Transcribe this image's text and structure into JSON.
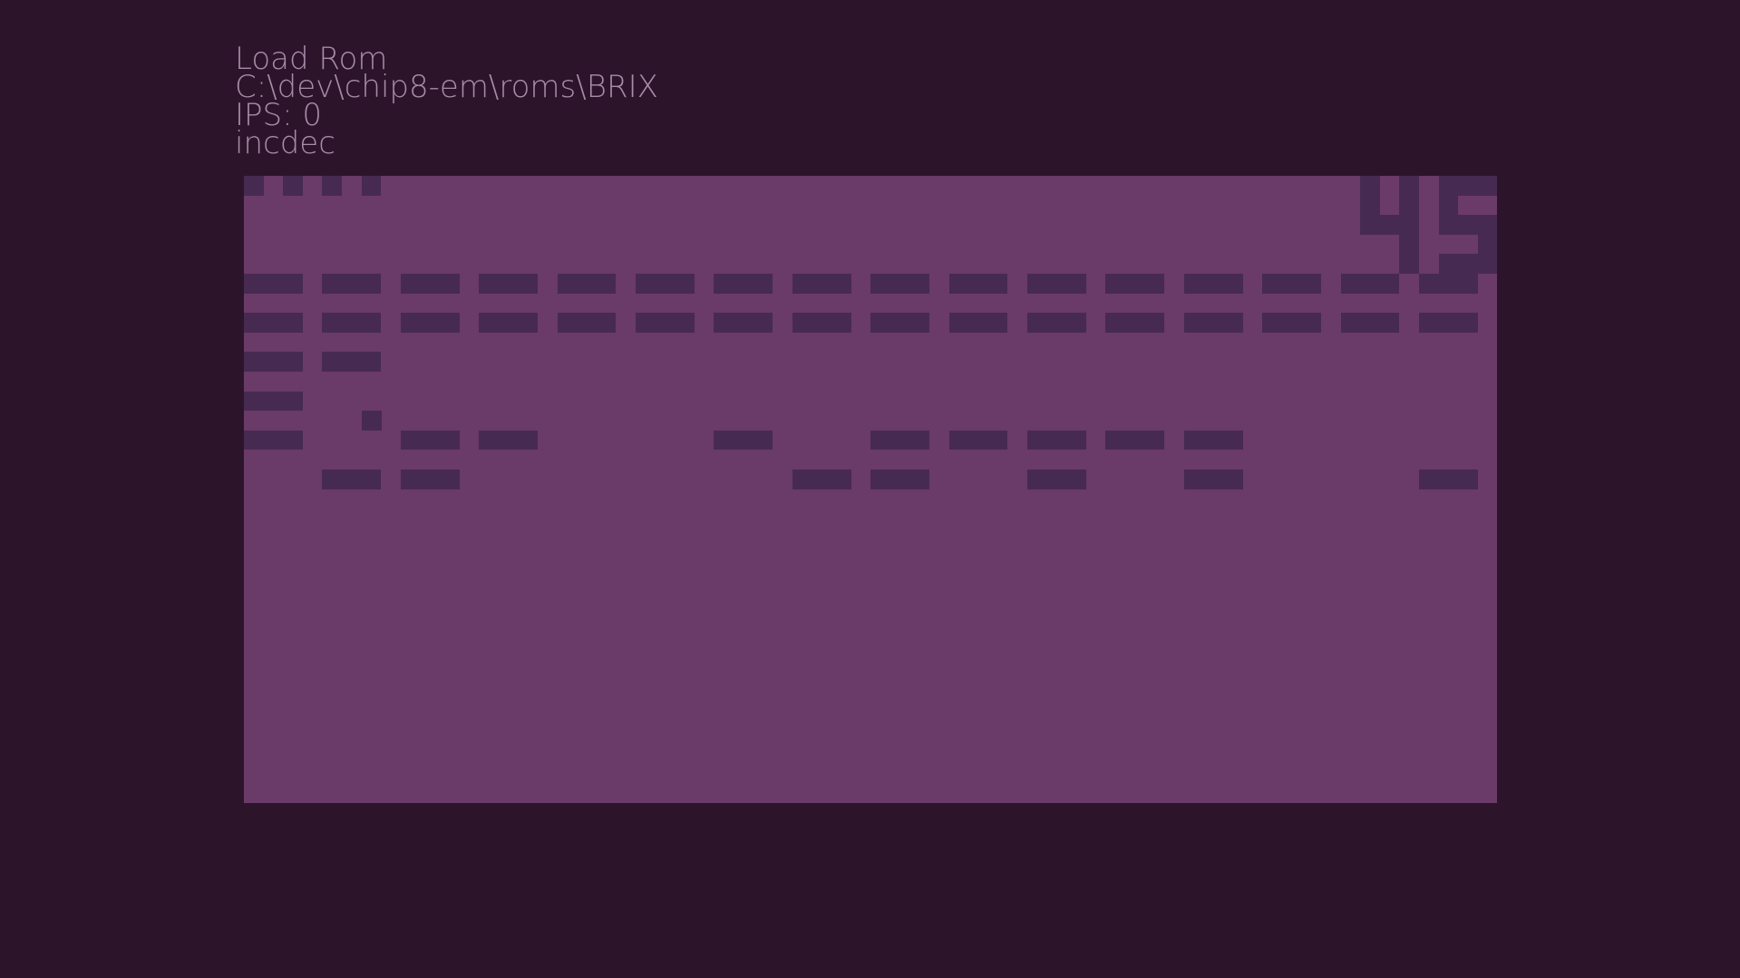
{
  "menu": {
    "load_rom_label": "Load Rom",
    "rom_path": "C:\\dev\\chip8-em\\roms\\BRIX",
    "ips_text": "IPS: 0",
    "mode_text": "incdec"
  },
  "colors": {
    "background": "#2c152b",
    "display_off": "#6a3a69",
    "display_on": "#472a52",
    "text": "#a98ca8"
  },
  "game": {
    "score": "45",
    "lives": 4,
    "brick_rows": [
      "1111111111111111",
      "1111111111111111",
      "1100000000000000",
      "1000000000000000",
      "1011001011111000",
      "0110000110101001"
    ]
  }
}
